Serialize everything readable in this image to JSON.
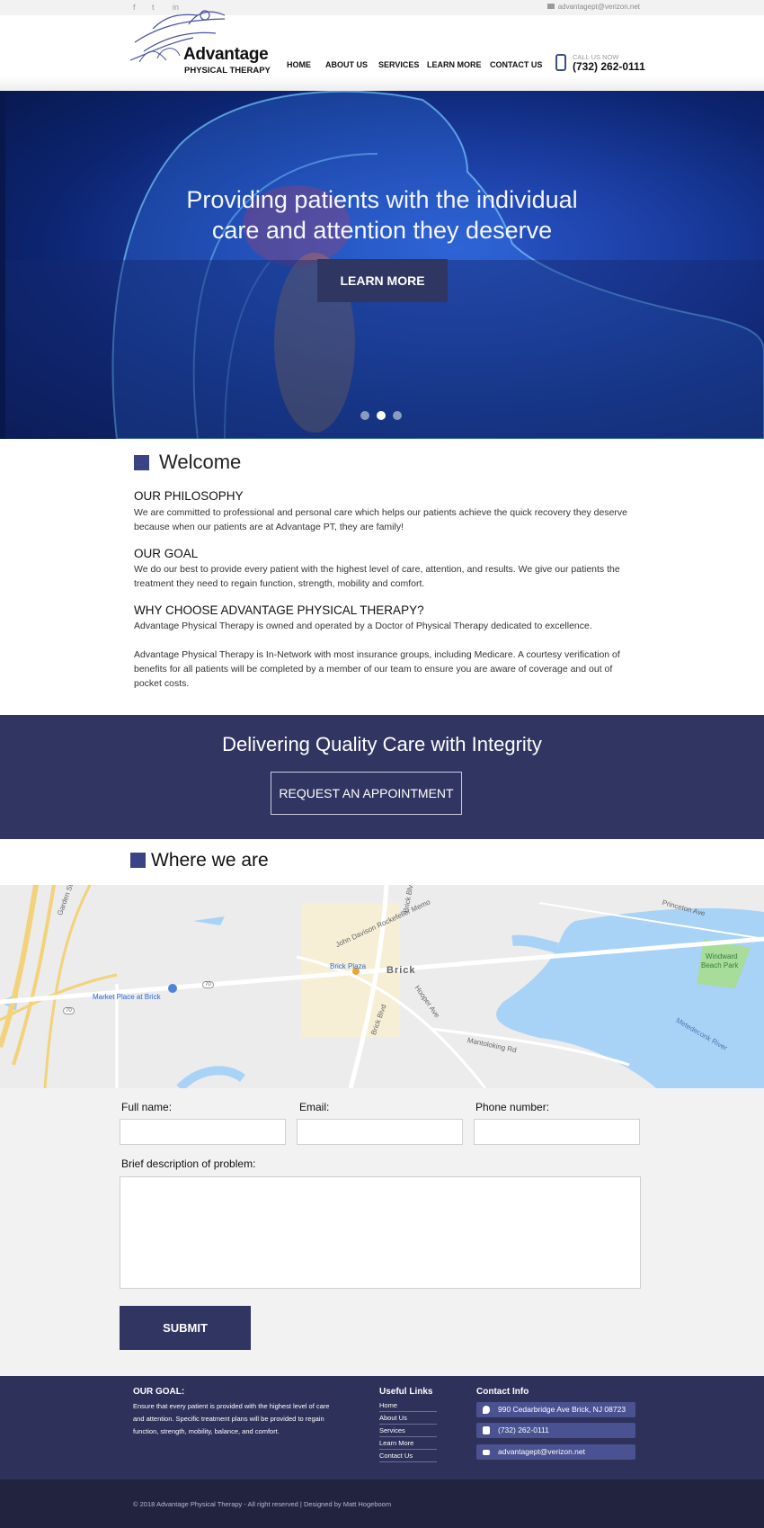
{
  "topbar": {
    "social": [
      "f",
      "t",
      "in"
    ],
    "email": "advantagept@verizon.net"
  },
  "header": {
    "logo_main": "Advantage",
    "logo_sub": "PHYSICAL THERAPY",
    "nav": [
      "HOME",
      "ABOUT US",
      "SERVICES",
      "LEARN MORE",
      "CONTACT US"
    ],
    "call_label": "CALL US NOW",
    "phone": "(732) 262-0111"
  },
  "hero": {
    "line1": "Providing patients with the individual",
    "line2": "care and attention they deserve",
    "button": "LEARN MORE",
    "slides": 3,
    "active_slide": 2
  },
  "welcome": {
    "title": "Welcome",
    "philosophy_title": "OUR PHILOSOPHY",
    "philosophy_l1": "We are committed to professional and personal care which helps our patients achieve the quick recovery they deserve",
    "philosophy_l2": "because when our patients are at Advantage PT, they are family!",
    "goal_title": "OUR GOAL",
    "goal_l1": "We do our best to provide every patient with the highest level of care, attention, and results. We give our patients the",
    "goal_l2": "treatment they need to regain function, strength, mobility and comfort.",
    "why_title": "WHY CHOOSE ADVANTAGE PHYSICAL THERAPY?",
    "why_l1": "Advantage Physical Therapy is owned and operated by a Doctor of Physical Therapy dedicated to excellence.",
    "network_l1": "Advantage Physical Therapy is In-Network with most insurance groups, including Medicare. A courtesy verification of",
    "network_l2": "benefits for all patients will be completed by a member of our team to ensure you are aware of coverage and out of",
    "network_l3": "pocket costs."
  },
  "banner": {
    "title": "Delivering Quality Care with Integrity",
    "button": "REQUEST AN APPOINTMENT"
  },
  "where": {
    "title": "Where we are"
  },
  "map": {
    "labels": {
      "gsp": "Garden State Pkwy",
      "jdr": "John Davison Rockefeller Memo",
      "brick_blvd_n": "Brick Blvd",
      "princeton": "Princeton Ave",
      "windward_1": "Windward",
      "windward_2": "Beach Park",
      "brick_plaza": "Brick Plaza",
      "brick": "Brick",
      "market_place": "Market Place at Brick",
      "r70a": "70",
      "r70b": "70",
      "hooper": "Hooper Ave",
      "brick_blvd_s": "Brick Blvd",
      "mantoloking": "Mantoloking Rd",
      "river": "Metedeconk River"
    }
  },
  "form": {
    "full_name_label": "Full name:",
    "email_label": "Email:",
    "phone_label": "Phone number:",
    "desc_label": "Brief description of problem:",
    "submit": "SUBMIT"
  },
  "footer": {
    "goal_title": "OUR GOAL:",
    "goal_l1": "Ensure that every patient is provided with the highest level of care",
    "goal_l2": "and attention. Specific treatment plans will be provided to regain",
    "goal_l3": "function, strength, mobility, balance, and comfort.",
    "links_title": "Useful Links",
    "links": [
      "Home",
      "About Us",
      "Services",
      "Learn More",
      "Contact Us"
    ],
    "contact_title": "Contact Info",
    "address": "990 Cedarbridge Ave Brick, NJ 08723",
    "phone": "(732) 262-0111",
    "email": "advantagept@verizon.net",
    "copyright": "© 2018 Advantage Physical Therapy -  All right reserved  |  Designed by Matt Hogeboom"
  },
  "colors": {
    "brand_navy": "#313561",
    "accent_square": "#3b4285",
    "footer_bg": "#2e315a",
    "bottom_bar": "#22243f"
  }
}
